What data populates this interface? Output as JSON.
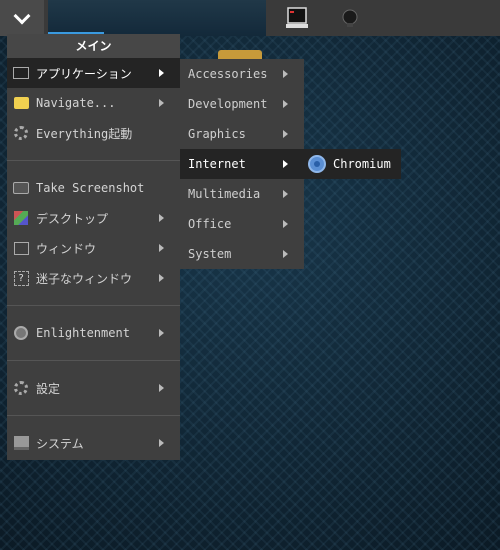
{
  "menu": {
    "title": "メイン",
    "items": [
      {
        "label": "アプリケーション",
        "icon": "terminal-icon",
        "selected": true,
        "has_submenu": true
      },
      {
        "label": "Navigate...",
        "icon": "folder-icon",
        "has_submenu": true
      },
      {
        "label": "Everything起動",
        "icon": "gear-icon",
        "has_submenu": false
      },
      {
        "label": "Take Screenshot",
        "icon": "camera-icon",
        "has_submenu": false
      },
      {
        "label": "デスクトップ",
        "icon": "desktop-icon",
        "has_submenu": true
      },
      {
        "label": "ウィンドウ",
        "icon": "window-icon",
        "has_submenu": true
      },
      {
        "label": "迷子なウィンドウ",
        "icon": "lost-window-icon",
        "has_submenu": true
      },
      {
        "label": "Enlightenment",
        "icon": "enlightenment-icon",
        "has_submenu": true
      },
      {
        "label": "設定",
        "icon": "settings-icon",
        "has_submenu": true
      },
      {
        "label": "システム",
        "icon": "system-icon",
        "has_submenu": true
      }
    ]
  },
  "apps_submenu": {
    "items": [
      {
        "label": "Accessories"
      },
      {
        "label": "Development"
      },
      {
        "label": "Graphics"
      },
      {
        "label": "Internet",
        "selected": true
      },
      {
        "label": "Multimedia"
      },
      {
        "label": "Office"
      },
      {
        "label": "System"
      }
    ]
  },
  "internet_submenu": {
    "items": [
      {
        "label": "Chromium",
        "icon": "chromium-icon"
      }
    ]
  },
  "colors": {
    "menu_bg": "#3f3f3f",
    "selected_bg": "#242424",
    "accent": "#3a9ae0"
  }
}
